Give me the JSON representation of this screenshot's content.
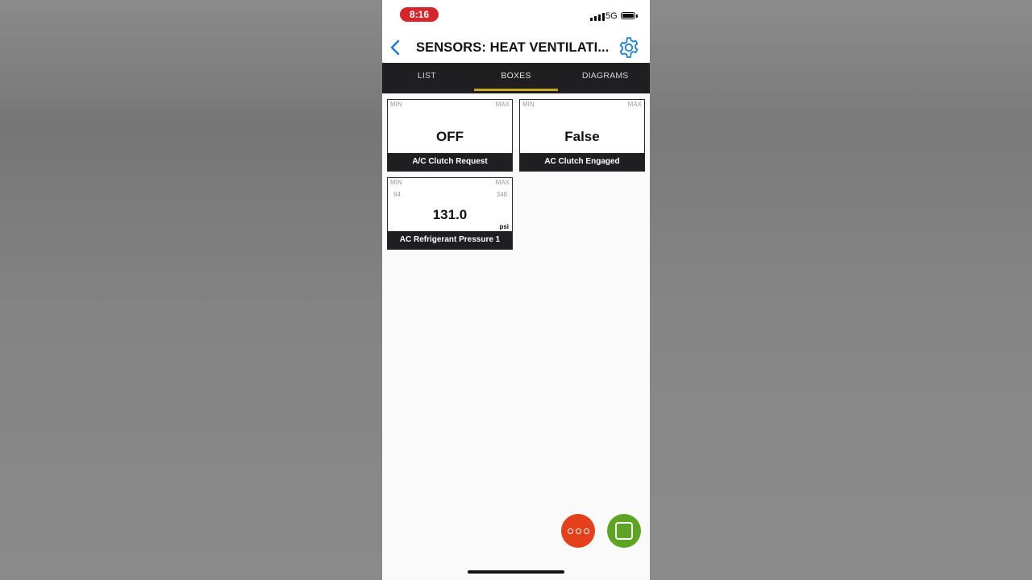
{
  "status_bar": {
    "time": "8:16",
    "network": "5G"
  },
  "header": {
    "title": "SENSORS: HEAT VENTILATI..."
  },
  "tabs": [
    {
      "label": "LIST",
      "active": false
    },
    {
      "label": "BOXES",
      "active": true
    },
    {
      "label": "DIAGRAMS",
      "active": false
    }
  ],
  "boxes": [
    {
      "min_label": "MIN",
      "max_label": "MAX",
      "min_value": "",
      "max_value": "",
      "value": "OFF",
      "unit": "",
      "label": "A/C Clutch Request"
    },
    {
      "min_label": "MIN",
      "max_label": "MAX",
      "min_value": "",
      "max_value": "",
      "value": "False",
      "unit": "",
      "label": "AC Clutch Engaged"
    },
    {
      "min_label": "MIN",
      "max_label": "MAX",
      "min_value": "94",
      "max_value": "348",
      "value": "131.0",
      "unit": "psi",
      "label": "AC Refrigerant Pressure 1"
    }
  ],
  "colors": {
    "accent": "#c9a628",
    "time_pill": "#d7262b",
    "fab_menu": "#e4401b",
    "fab_stop": "#5da324",
    "tab_bar": "#1f1f22",
    "icon_blue": "#1e7fd1"
  },
  "icons": {
    "back": "chevron-left-icon",
    "settings": "gear-icon",
    "menu": "more-dots-icon",
    "stop": "stop-square-icon"
  }
}
